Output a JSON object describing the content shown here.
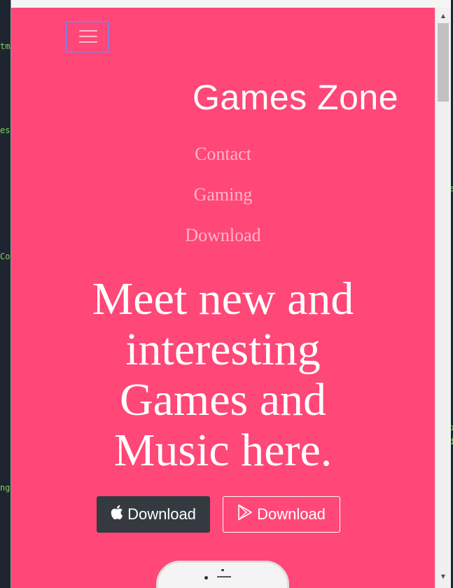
{
  "background_window": {
    "snippets": [
      "tm",
      "es",
      "Co",
      "e",
      "p",
      "d",
      "ng"
    ]
  },
  "page": {
    "accent_color": "#ff4778",
    "navbar": {
      "toggle_icon": "hamburger-menu-icon",
      "brand": "Games Zone",
      "links": [
        "Contact",
        "Gaming",
        "Download"
      ]
    },
    "hero": {
      "headline_lines": [
        "Meet new and",
        "interesting",
        "Games and",
        "Music here."
      ],
      "buttons": [
        {
          "icon": "apple-icon",
          "label": "Download"
        },
        {
          "icon": "google-play-icon",
          "label": "Download"
        }
      ]
    }
  },
  "scrollbar": {
    "up_arrow": "▲",
    "down_arrow": "▼"
  }
}
